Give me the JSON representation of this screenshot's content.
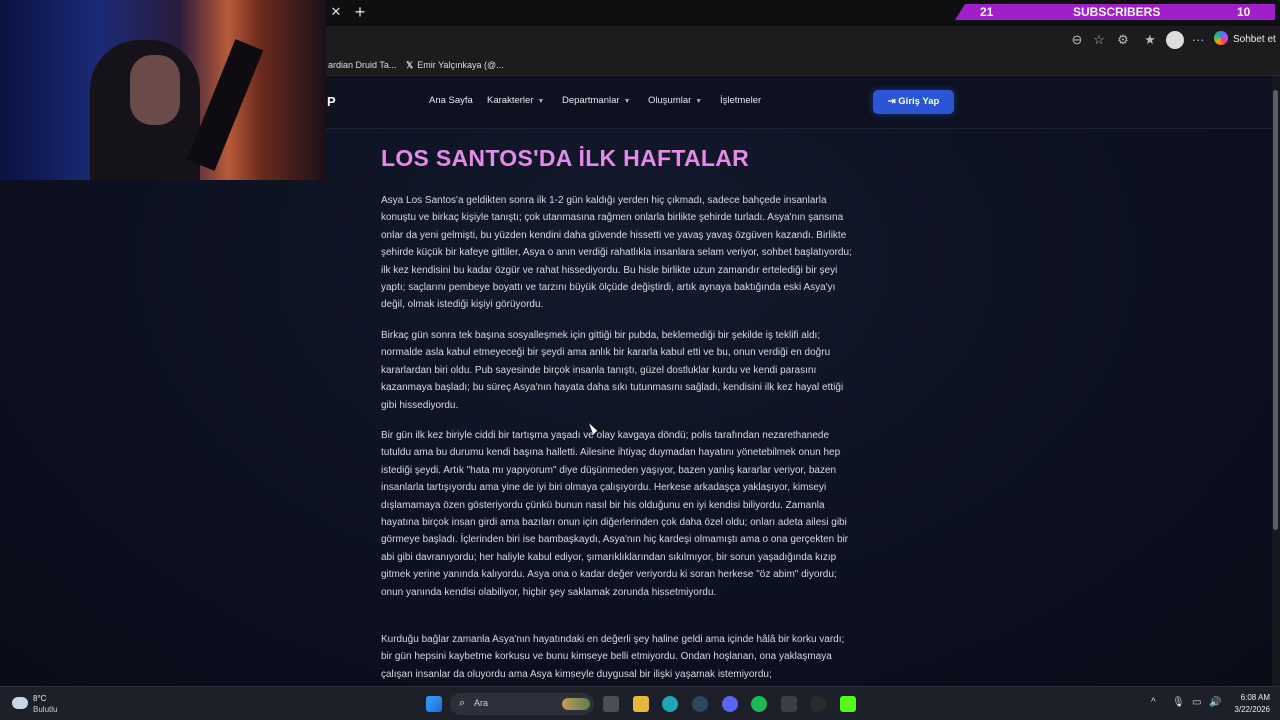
{
  "browser": {
    "new_tab_symbol": "+",
    "close_symbol": "✕",
    "bookmarks": [
      {
        "label": "ardian Druid Ta..."
      },
      {
        "label": "Emir Yalçınkaya (@..."
      }
    ],
    "copilot_label": "Sohbet et",
    "menu_symbol": "···"
  },
  "stream_overlay": {
    "left_count": "21",
    "label": "SUBSCRIBERS",
    "right_count": "10",
    "color": "#a01fc9"
  },
  "site": {
    "logo": "P",
    "nav": [
      {
        "label": "Ana Sayfa"
      },
      {
        "label": "Karakterler"
      },
      {
        "label": "Departmanlar"
      },
      {
        "label": "Oluşumlar"
      },
      {
        "label": "İşletmeler"
      }
    ],
    "login_label": "Giriş Yap",
    "accent": "#2a56d6"
  },
  "article": {
    "title": "LOS SANTOS'DA İLK HAFTALAR",
    "title_color": "#e58ae8",
    "paragraphs": [
      "Asya Los Santos'a geldikten sonra ilk 1-2 gün kaldığı yerden hiç çıkmadı, sadece bahçede insanlarla konuştu ve birkaç kişiyle tanıştı; çok utanmasına rağmen onlarla birlikte şehirde turladı. Asya'nın şansına onlar da yeni gelmişti, bu yüzden kendini daha güvende hissetti ve yavaş yavaş özgüven kazandı. Birlikte şehirde küçük bir kafeye gittiler, Asya o anın verdiği rahatlıkla insanlara selam veriyor, sohbet başlatıyordu; ilk kez kendisini bu kadar özgür ve rahat hissediyordu. Bu hisle birlikte uzun zamandır ertelediği bir şeyi yaptı; saçlarını pembeye boyattı ve tarzını büyük ölçüde değiştirdi, artık aynaya baktığında eski Asya'yı değil, olmak istediği kişiyi görüyordu.",
      "Birkaç gün sonra tek başına sosyalleşmek için gittiği bir pubda, beklemediği bir şekilde iş teklifi aldı; normalde asla kabul etmeyeceği bir şeydi ama anlık bir kararla kabul etti ve bu, onun verdiği en doğru kararlardan biri oldu. Pub sayesinde birçok insanla tanıştı, güzel dostluklar kurdu ve kendi parasını kazanmaya başladı; bu süreç Asya'nın hayata daha sıkı tutunmasını sağladı, kendisini ilk kez hayal ettiği gibi hissediyordu.",
      "Bir gün ilk kez biriyle ciddi bir tartışma yaşadı ve olay kavgaya döndü; polis tarafından nezarethanede tutuldu ama bu durumu kendi başına halletti. Ailesine ihtiyaç duymadan hayatını yönetebilmek onun hep istediği şeydi. Artık \"hata mı yapıyorum\" diye düşünmeden yaşıyor, bazen yanlış kararlar veriyor, bazen insanlarla tartışıyordu ama yine de iyi biri olmaya çalışıyordu. Herkese arkadaşça yaklaşıyor, kimseyi dışlamamaya özen gösteriyordu çünkü bunun nasıl bir his olduğunu en iyi kendisi biliyordu. Zamanla hayatına birçok insan girdi ama bazıları onun için diğerlerinden çok daha özel oldu; onları adeta ailesi gibi görmeye başladı. İçlerinden biri ise bambaşkaydı, Asya'nın hiç kardeşi olmamıştı ama o ona gerçekten bir abi gibi davranıyordu; her haliyle kabul ediyor, şımarıklıklarından sıkılmıyor, bir sorun yaşadığında kızıp gitmek yerine yanında kalıyordu. Asya ona o kadar değer veriyordu ki soran herkese \"öz abim\" diyordu; onun yanında kendisi olabiliyor, hiçbir şey saklamak zorunda hissetmiyordu.",
      "Kurduğu bağlar zamanla Asya'nın hayatındaki en değerli şey haline geldi ama içinde hâlâ bir korku vardı; bir gün hepsini kaybetme korkusu ve bunu kimseye belli etmiyordu. Ondan hoşlanan, ona yaklaşmaya çalışan insanlar da oluyordu ama Asya kimseyle duygusal bir ilişki yaşamak istemiyordu;"
    ]
  },
  "taskbar": {
    "weather_temp": "8°C",
    "weather_desc": "Bulutlu",
    "search_label": "Ara",
    "time": "6:08 AM",
    "date": "3/22/2026"
  }
}
